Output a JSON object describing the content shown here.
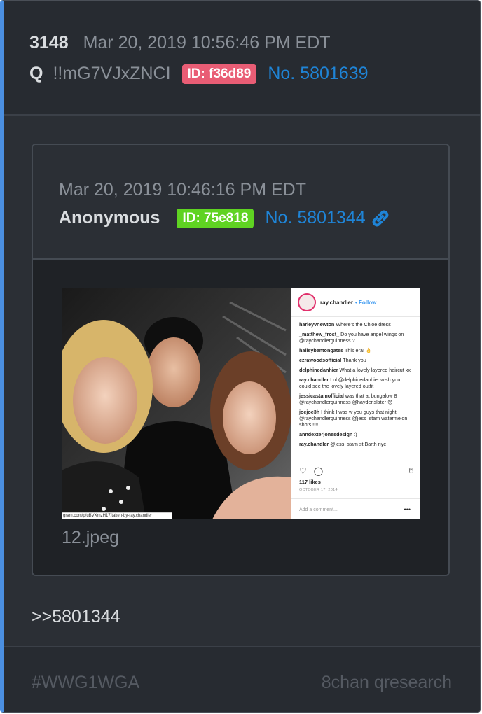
{
  "post": {
    "number": "3148",
    "timestamp": "Mar 20, 2019 10:56:46 PM EDT",
    "name": "Q",
    "tripcode": "!!mG7VJxZNCI",
    "id_badge": "ID: f36d89",
    "id_color": "#e95d75",
    "post_no": "No. 5801639",
    "reply_text": ">>5801344"
  },
  "quoted": {
    "timestamp": "Mar 20, 2019 10:46:16 PM EDT",
    "name": "Anonymous",
    "id_badge": "ID: 75e818",
    "id_color": "#5fd322",
    "post_no": "No. 5801344",
    "link_icon": "link-icon",
    "filename": "12.jpeg",
    "image": {
      "url_text": "gram.com/p/uBVXmzH17/taken-by-ray.chandler",
      "instagram": {
        "username": "ray.chandler",
        "follow": "• Follow",
        "comments": [
          {
            "user": "harleyvnewton",
            "text": "Where's the Chloe dress"
          },
          {
            "user": "_matthew_frost_",
            "text": "Do you have angel wings on @raychandlerguinness ?"
          },
          {
            "user": "halleybentongates",
            "text": "This era! 👌"
          },
          {
            "user": "ezrawoodsofficial",
            "text": "Thank you"
          },
          {
            "user": "delphinedanhier",
            "text": "What a lovely layered haircut xx"
          },
          {
            "user": "ray.chandler",
            "text": "Lol @delphinedanhier wish you could see the lovely layered outfit"
          },
          {
            "user": "jessicastamofficial",
            "text": "was that at bungalow 8 @raychandlerguinness @haydenslater 😯"
          },
          {
            "user": "joejoe3h",
            "text": "I think I was w you guys that night @raychandlerguinness @jess_stam watermelon shots !!!!"
          },
          {
            "user": "anndexterjonesdesign",
            "text": ":)"
          },
          {
            "user": "ray.chandler",
            "text": "@jess_stam st Barth nye"
          }
        ],
        "likes": "117 likes",
        "date": "OCTOBER 17, 2014",
        "add_comment": "Add a comment...",
        "more": "•••"
      }
    }
  },
  "footer": {
    "hashtag": "#WWG1WGA",
    "site": "8chan qresearch"
  }
}
